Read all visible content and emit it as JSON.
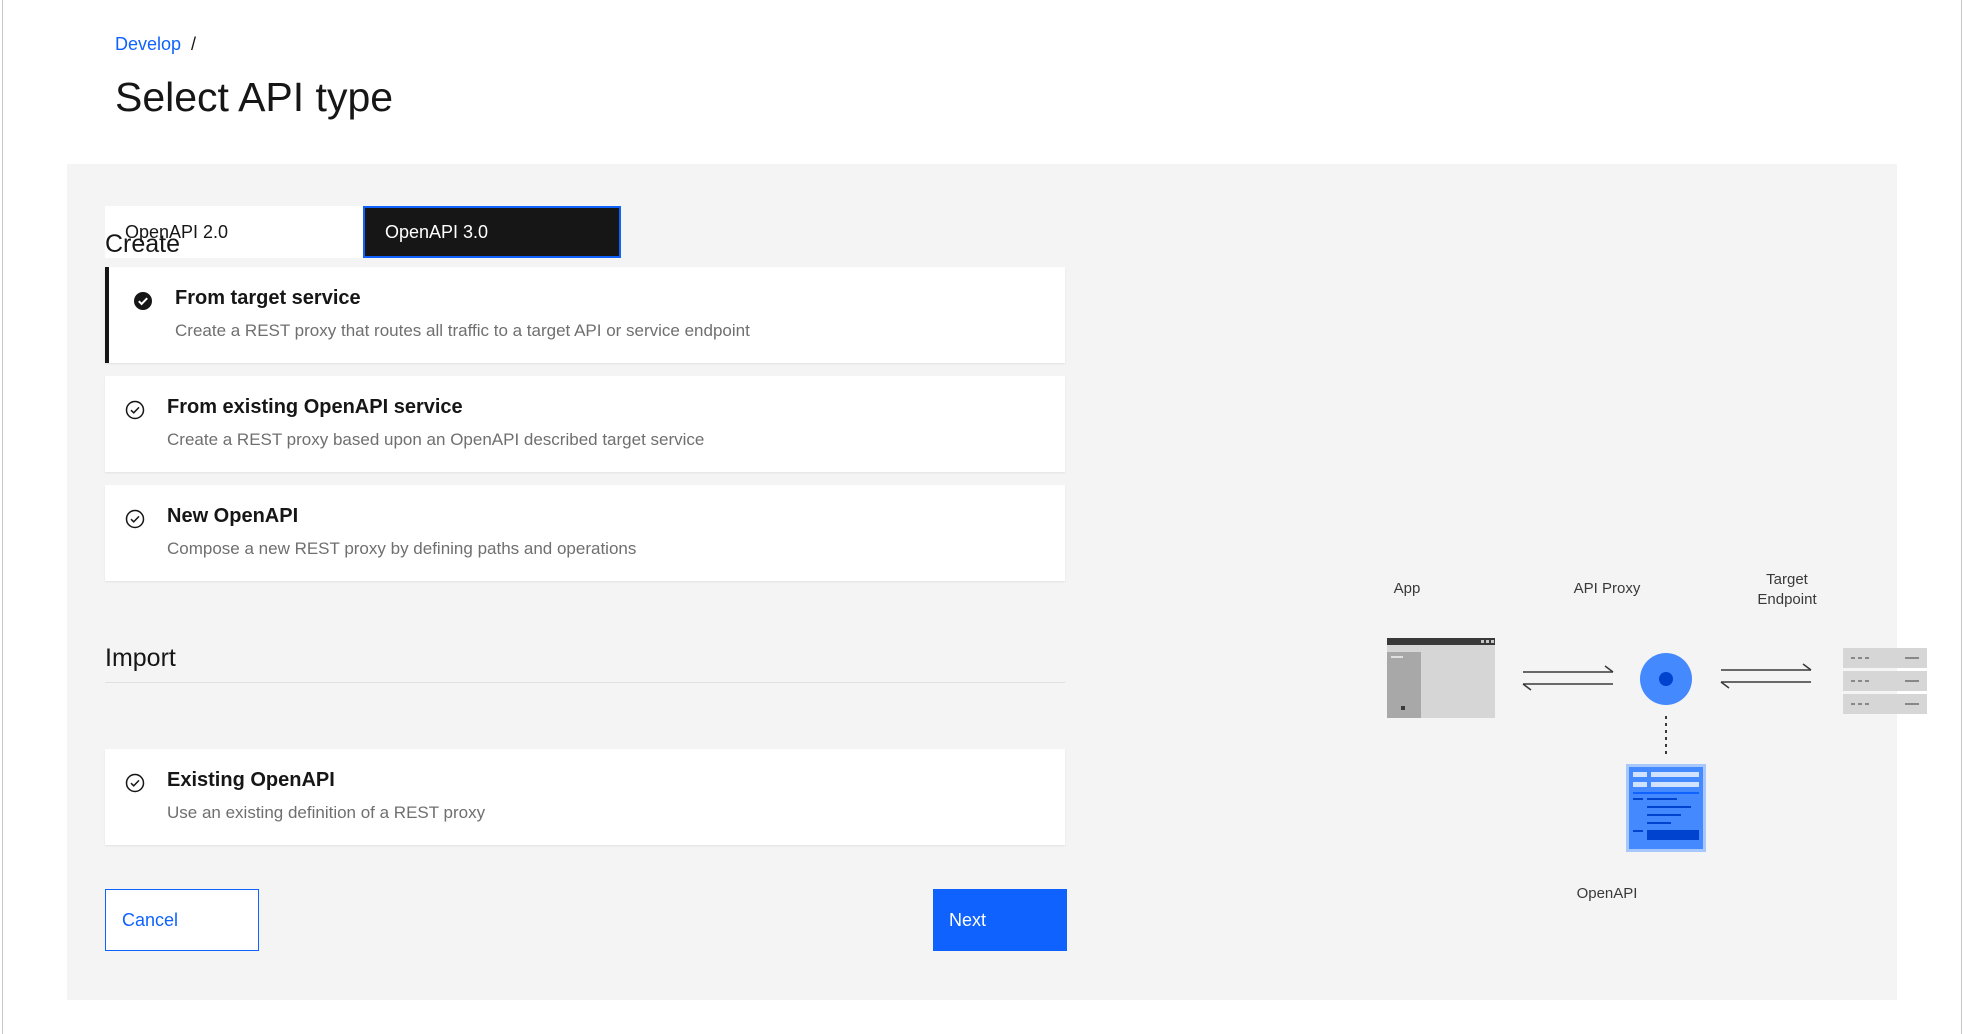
{
  "breadcrumb": {
    "link": "Develop",
    "separator": "/"
  },
  "page": {
    "title": "Select API type"
  },
  "switcher": {
    "option_1": "OpenAPI 2.0",
    "option_2": "OpenAPI 3.0",
    "selected": "OpenAPI 3.0"
  },
  "create": {
    "heading": "Create",
    "tiles": [
      {
        "title": "From target service",
        "description": "Create a REST proxy that routes all traffic to a target API or service endpoint",
        "selected": true
      },
      {
        "title": "From existing OpenAPI service",
        "description": "Create a REST proxy based upon an OpenAPI described target service",
        "selected": false
      },
      {
        "title": "New OpenAPI",
        "description": "Compose a new REST proxy by defining paths and operations",
        "selected": false
      }
    ]
  },
  "import": {
    "heading": "Import",
    "tiles": [
      {
        "title": "Existing OpenAPI",
        "description": "Use an existing definition of a REST proxy",
        "selected": false
      }
    ]
  },
  "actions": {
    "cancel_label": "Cancel",
    "next_label": "Next"
  },
  "diagram": {
    "app_label": "App",
    "proxy_label": "API Proxy",
    "target_label_line1": "Target",
    "target_label_line2": "Endpoint",
    "openapi_label": "OpenAPI"
  },
  "colors": {
    "accent": "#0f62fe",
    "dark": "#161616",
    "panel": "#f4f4f4",
    "diagram_blue": "#4589ff"
  }
}
